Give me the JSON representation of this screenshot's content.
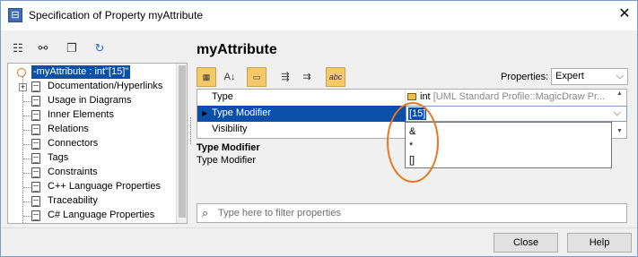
{
  "window": {
    "title": "Specification of Property myAttribute",
    "close": "✕"
  },
  "left_toolbar": {
    "icons": [
      "list-icon",
      "tree-icon",
      "copy-icon",
      "refresh-icon"
    ],
    "glyphs": [
      "☷",
      "⚯",
      "❐",
      "↻"
    ]
  },
  "tree": {
    "root": {
      "label": "-myAttribute : int\"[15]\""
    },
    "items": [
      {
        "label": "Documentation/Hyperlinks",
        "expandable": true
      },
      {
        "label": "Usage in Diagrams"
      },
      {
        "label": "Inner Elements"
      },
      {
        "label": "Relations"
      },
      {
        "label": "Connectors"
      },
      {
        "label": "Tags"
      },
      {
        "label": "Constraints"
      },
      {
        "label": "C++ Language Properties"
      },
      {
        "label": "Traceability"
      },
      {
        "label": "C# Language Properties"
      }
    ]
  },
  "main": {
    "heading": "myAttribute",
    "toolbar": {
      "buttons": [
        "group-by-category",
        "sort-alphabetically",
        "show-description",
        "expand-all",
        "collapse-all",
        "abc-spell"
      ],
      "properties_label": "Properties:",
      "properties_value": "Expert"
    },
    "grid": {
      "rows": [
        {
          "name": "Type",
          "value": "int",
          "value_gray": "[UML Standard Profile::MagicDraw Pr..."
        },
        {
          "name": "Type Modifier",
          "value": "[15]",
          "active": true
        },
        {
          "name": "Visibility",
          "value": ""
        }
      ],
      "dropdown_options": [
        "&",
        "*",
        "[]"
      ]
    },
    "description": {
      "title": "Type Modifier",
      "text": "Type Modifier"
    },
    "filter": {
      "placeholder": "Type here to filter properties"
    }
  },
  "buttons": {
    "close": "Close",
    "help": "Help"
  },
  "colors": {
    "selection": "#0a4fa8",
    "highlight_ring": "#e87722",
    "toolbar_active": "#f5c96a"
  }
}
